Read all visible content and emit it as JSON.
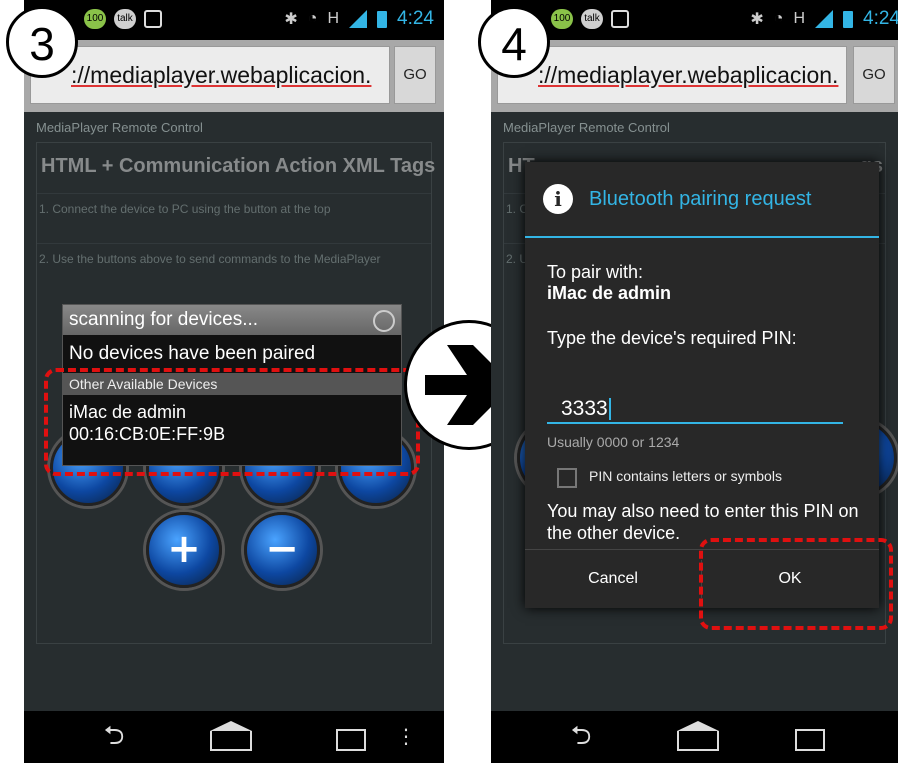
{
  "left_panel": {
    "step_number": "3",
    "status_bar": {
      "badge_100": "100",
      "talk": "talk",
      "time": "4:24",
      "network": "H"
    },
    "browser": {
      "url": "://mediaplayer.webaplicacion.",
      "go_label": "GO"
    },
    "page": {
      "header": "MediaPlayer Remote Control",
      "title": "HTML + Communication Action XML Tags",
      "step1": "1. Connect the device to PC using the button at the top",
      "step2": "2. Use the buttons above to send commands to the MediaPlayer"
    },
    "scan_dialog": {
      "title": "scanning for devices...",
      "no_devices": "No devices have been paired",
      "other_header": "Other Available Devices",
      "device_name": "iMac de admin",
      "device_mac": "00:16:CB:0E:FF:9B"
    },
    "media_buttons": {
      "plus": "+",
      "minus": "−"
    },
    "nav": {
      "back": "⮌",
      "menu": "⋮"
    }
  },
  "right_panel": {
    "step_number": "4",
    "status_bar": {
      "badge_100": "100",
      "talk": "talk",
      "time": "4:24",
      "network": "H"
    },
    "browser": {
      "url": "://mediaplayer.webaplicacion.",
      "go_label": "GO"
    },
    "page": {
      "header": "MediaPlayer Remote Control",
      "title_partial": "HT",
      "title_tail": "gs",
      "step1_partial": "1. C",
      "step2_partial": "2. U"
    },
    "pairing_dialog": {
      "title": "Bluetooth pairing request",
      "pair_with_label": "To pair with:",
      "device_name": "iMac de admin",
      "pin_prompt": "Type the device's required PIN:",
      "pin_value": "3333",
      "pin_hint": "Usually 0000 or 1234",
      "checkbox_label": "PIN contains letters or symbols",
      "note": "You may also need to enter this PIN on the other device.",
      "cancel_label": "Cancel",
      "ok_label": "OK"
    },
    "nav": {
      "back": "⮌"
    }
  },
  "colors": {
    "accent": "#33b5e5",
    "highlight": "#e01010",
    "dialog_bg": "#282828"
  }
}
